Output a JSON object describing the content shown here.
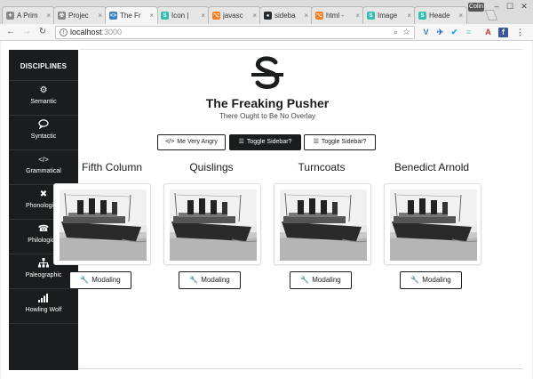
{
  "browser": {
    "tabs": [
      {
        "title": "A Prim",
        "fav_color": "#888888",
        "fav_glyph": "✦"
      },
      {
        "title": "Projec",
        "fav_color": "#888888",
        "fav_glyph": "☢"
      },
      {
        "title": "The Fr",
        "fav_color": "#3b82c4",
        "fav_glyph": "<>"
      },
      {
        "title": "Icon |",
        "fav_color": "#35bdb2",
        "fav_glyph": "S"
      },
      {
        "title": "javasc",
        "fav_color": "#f48024",
        "fav_glyph": "⌥"
      },
      {
        "title": "sideba",
        "fav_color": "#24292e",
        "fav_glyph": "●"
      },
      {
        "title": "html -",
        "fav_color": "#f48024",
        "fav_glyph": "⌥"
      },
      {
        "title": "Image",
        "fav_color": "#35bdb2",
        "fav_glyph": "S"
      },
      {
        "title": "Heade",
        "fav_color": "#35bdb2",
        "fav_glyph": "S"
      }
    ],
    "profile_label": "Colin",
    "address": {
      "host": "localhost",
      "port": ":3000"
    }
  },
  "sidebar": {
    "header": "DISCIPLINES",
    "items": [
      {
        "label": "Semantic",
        "icon": "cogs-icon",
        "glyph": "⚙"
      },
      {
        "label": "Syntactic",
        "icon": "comment-icon",
        "glyph": "🗨"
      },
      {
        "label": "Grammatical",
        "icon": "code-icon",
        "glyph": "</>"
      },
      {
        "label": "Phonological",
        "icon": "close-icon",
        "glyph": "✖"
      },
      {
        "label": "Philological",
        "icon": "phone-icon",
        "glyph": "☎"
      },
      {
        "label": "Paleographic",
        "icon": "sitemap-icon",
        "glyph": "⊞"
      },
      {
        "label": "Howling Wolf",
        "icon": "signal-icon",
        "glyph": "▁▃▅▇"
      }
    ]
  },
  "header": {
    "title": "The Freaking Pusher",
    "subtitle": "There Ought to Be No Overlay"
  },
  "buttons": [
    {
      "label": "Me Very Angry",
      "icon": "code-icon",
      "glyph": "</>"
    },
    {
      "label": "Toggle Sidebar?",
      "icon": "list-icon",
      "glyph": "☰"
    },
    {
      "label": "Toggle Sidebar?",
      "icon": "list-icon",
      "glyph": "☰"
    }
  ],
  "cards": [
    {
      "title": "Fifth Column",
      "button": "Modaling"
    },
    {
      "title": "Quislings",
      "button": "Modaling"
    },
    {
      "title": "Turncoats",
      "button": "Modaling"
    },
    {
      "title": "Benedict Arnold",
      "button": "Modaling"
    }
  ],
  "colors": {
    "sidebar_bg": "#1b1c1d",
    "accent_dark": "#1b1c1d"
  }
}
